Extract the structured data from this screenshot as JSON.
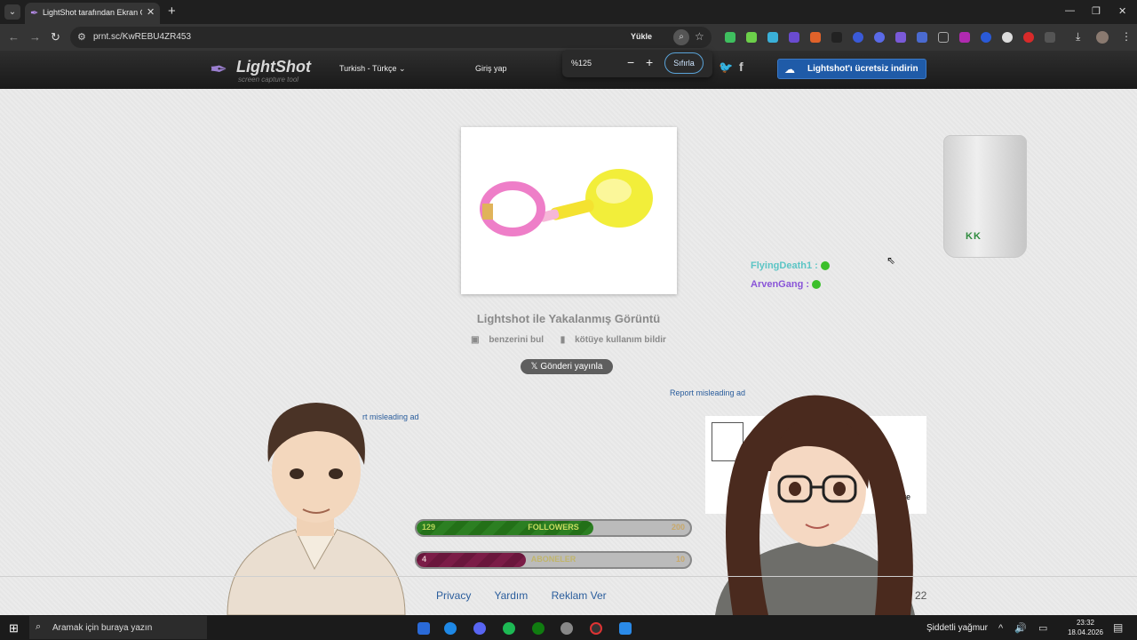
{
  "browser": {
    "tab_title": "LightShot tarafından Ekran Görü",
    "url": "prnt.sc/KwREBU4ZR453",
    "upload_label": "Yükle"
  },
  "zoom_popup": {
    "level": "%125",
    "minus": "−",
    "plus": "+",
    "reset_label": "Sıfırla"
  },
  "header": {
    "logo": "LightShot",
    "tagline": "screen capture tool",
    "language": "Turkish - Türkçe",
    "login": "Giriş yap",
    "download_label": "Lightshot'ı ücretsiz indirin"
  },
  "main": {
    "title": "Lightshot ile Yakalanmış Görüntü",
    "find_similar": "benzerini bul",
    "report_abuse": "kötüye kullanım bildir",
    "tweet_label": "Gönderi yayınla",
    "report_ad_right": "Report misleading ad",
    "report_ad_left": "rt misleading ad",
    "ad_share": "Share"
  },
  "overlay": {
    "glass_text": "KK",
    "chat": [
      {
        "user": "FlyingDeath1 :"
      },
      {
        "user": "ArvenGang :"
      }
    ],
    "followers": {
      "current": "129",
      "label": "FOLLOWERS",
      "goal": "200",
      "progress": 0.645
    },
    "subscribers": {
      "current": "4",
      "label": "ABONELER",
      "goal": "10",
      "progress": 0.4
    }
  },
  "footer": {
    "links": [
      "Privacy",
      "Yardım",
      "Reklam Ver"
    ],
    "number": "22"
  },
  "taskbar": {
    "search_placeholder": "Aramak için buraya yazın",
    "weather": "Şiddetli yağmur",
    "time": "23:32",
    "date": "18.04.2026"
  },
  "colors": {
    "download_button": "#1f5ba8",
    "followers_bar": "#2c7f22",
    "subscribers_bar": "#7b1c47",
    "link": "#2a5d9c"
  }
}
